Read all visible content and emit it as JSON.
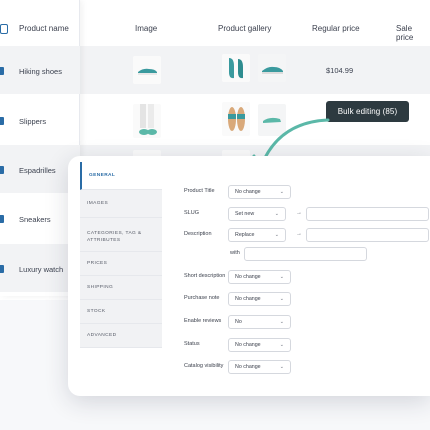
{
  "table": {
    "headers": {
      "product_name": "Product name",
      "image": "Image",
      "gallery": "Product gallery",
      "regular_price": "Regular price",
      "sale_price": "Sale price"
    },
    "rows": [
      {
        "name": "Hiking shoes",
        "price": "$104.99"
      },
      {
        "name": "Slippers",
        "price": ""
      },
      {
        "name": "Espadrilles",
        "price": ""
      },
      {
        "name": "Sneakers",
        "price": ""
      },
      {
        "name": "Luxury watch",
        "price": ""
      }
    ]
  },
  "bulk_label": "Bulk editing (85)",
  "colors": {
    "accent": "#2a6ca6",
    "teal_arrow": "#5bb8a8",
    "pill_bg": "#2d3a40"
  },
  "modal": {
    "nav": [
      {
        "label": "GENERAL",
        "active": true
      },
      {
        "label": "IMAGES",
        "active": false
      },
      {
        "label": "CATEGORIES, TAG & ATTRIBUTES",
        "active": false
      },
      {
        "label": "PRICES",
        "active": false
      },
      {
        "label": "SHIPPING",
        "active": false
      },
      {
        "label": "STOCK",
        "active": false
      },
      {
        "label": "ADVANCED",
        "active": false
      }
    ],
    "fields": {
      "product_title": {
        "label": "Product Title",
        "value": "No change"
      },
      "slug": {
        "label": "SLUG",
        "value": "Set new"
      },
      "description": {
        "label": "Description",
        "value": "Replace"
      },
      "with_label": "with",
      "short_description": {
        "label": "Short description",
        "value": "No change"
      },
      "purchase_note": {
        "label": "Purchase note",
        "value": "No change"
      },
      "enable_reviews": {
        "label": "Enable reviews",
        "value": "No"
      },
      "status": {
        "label": "Status",
        "value": "No change"
      },
      "catalog_visibility": {
        "label": "Catalog visibility",
        "value": "No change"
      }
    },
    "arrow_symbol": "→",
    "chevron": "⌄"
  },
  "icons": {
    "arrow": "curved-arrow-icon",
    "checkbox": "checkbox-icon"
  }
}
